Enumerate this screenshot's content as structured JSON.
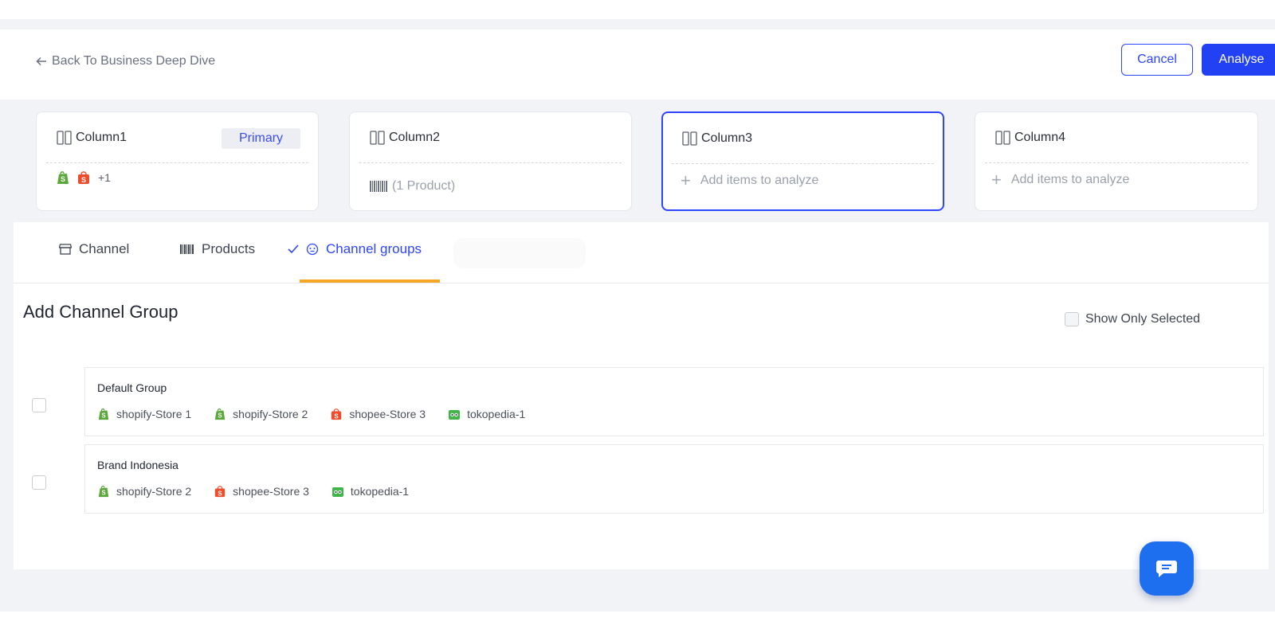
{
  "header": {
    "back_label": "Back To Business Deep Dive",
    "cancel_label": "Cancel",
    "analyse_label": "Analyse"
  },
  "columns": [
    {
      "title": "Column1",
      "badge": "Primary",
      "extra_count": "+1"
    },
    {
      "title": "Column2",
      "body": "(1 Product)"
    },
    {
      "title": "Column3",
      "body": "Add items to analyze"
    },
    {
      "title": "Column4",
      "body": "Add items to analyze"
    }
  ],
  "tabs": [
    {
      "label": "Channel",
      "icon": "store-icon"
    },
    {
      "label": "Products",
      "icon": "barcode-icon"
    },
    {
      "label": "Channel groups",
      "icon": "group-icon",
      "active": true
    }
  ],
  "section": {
    "title": "Add Channel Group",
    "show_only_selected": "Show Only Selected"
  },
  "groups": [
    {
      "name": "Default Group",
      "channels": [
        {
          "label": "shopify-Store 1",
          "platform": "shopify"
        },
        {
          "label": "shopify-Store 2",
          "platform": "shopify"
        },
        {
          "label": "shopee-Store 3",
          "platform": "shopee"
        },
        {
          "label": "tokopedia-1",
          "platform": "tokopedia"
        }
      ]
    },
    {
      "name": "Brand Indonesia",
      "channels": [
        {
          "label": "shopify-Store 2",
          "platform": "shopify"
        },
        {
          "label": "shopee-Store 3",
          "platform": "shopee"
        },
        {
          "label": "tokopedia-1",
          "platform": "tokopedia"
        }
      ]
    }
  ],
  "colors": {
    "accent": "#2e45ff",
    "tab_underline": "#f5a623",
    "shopify": "#5aa83a",
    "shopee": "#ee4d2d",
    "tokopedia": "#42b549",
    "chat_fab": "#1e6ef0"
  }
}
